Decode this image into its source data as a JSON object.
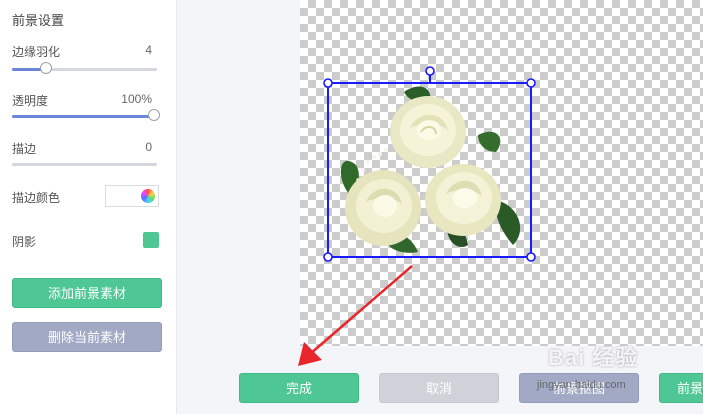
{
  "panel": {
    "title": "前景设置",
    "feather": {
      "label": "边缘羽化",
      "value": "4",
      "level_fraction": 0.22
    },
    "opacity": {
      "label": "透明度",
      "value": "100%",
      "level_fraction": 1.0
    },
    "stroke": {
      "label": "描边",
      "value": "0",
      "level_fraction": 0.0
    },
    "stroke_color": {
      "label": "描边颜色"
    },
    "shadow": {
      "label": "阴影",
      "color": "#4ec795"
    },
    "add_button": "添加前景素材",
    "delete_button": "删除当前素材"
  },
  "footer": {
    "done": "完成",
    "cancel": "取消",
    "front": "前景抠图",
    "more": "前景"
  },
  "watermark": {
    "text": "Bai 经验",
    "url": "jingyan.baidu.com"
  },
  "colors": {
    "accent_green": "#4ec795",
    "muted_blue": "#a2a9c4",
    "selection_blue": "#1a1aff",
    "arrow_red": "#e8262b"
  },
  "icons": [
    "color-wheel-icon",
    "rotate-handle-icon",
    "resize-handle-icon",
    "red-arrow-icon"
  ]
}
